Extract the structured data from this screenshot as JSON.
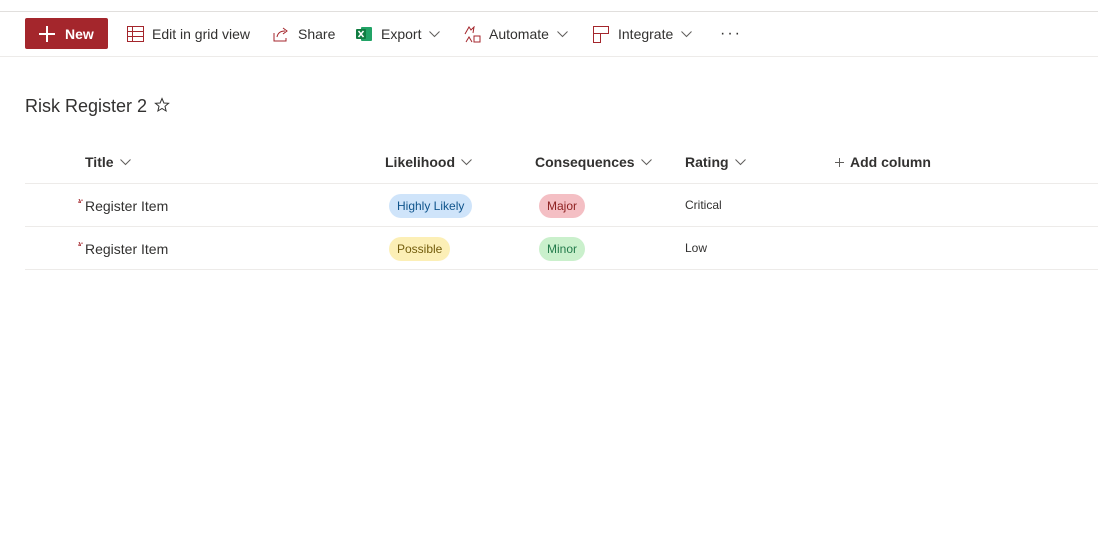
{
  "toolbar": {
    "new_label": "New",
    "edit_grid_label": "Edit in grid view",
    "share_label": "Share",
    "export_label": "Export",
    "automate_label": "Automate",
    "integrate_label": "Integrate",
    "more_label": "···"
  },
  "page": {
    "title": "Risk Register 2"
  },
  "columns": {
    "title": "Title",
    "likelihood": "Likelihood",
    "consequences": "Consequences",
    "rating": "Rating",
    "add_column": "Add column"
  },
  "rows": [
    {
      "title": "Register Item",
      "likelihood": "Highly Likely",
      "consequences": "Major",
      "rating": "Critical"
    },
    {
      "title": "Register Item",
      "likelihood": "Possible",
      "consequences": "Minor",
      "rating": "Low"
    }
  ],
  "colors": {
    "brand": "#a4262c",
    "pill_highly_likely_bg": "#cfe4fa",
    "pill_highly_likely_fg": "#0f548c",
    "pill_possible_bg": "#fcefb6",
    "pill_possible_fg": "#735d0c",
    "pill_major_bg": "#f4bfc4",
    "pill_major_fg": "#8e2222",
    "pill_minor_bg": "#caf0cc",
    "pill_minor_fg": "#237b4b"
  }
}
